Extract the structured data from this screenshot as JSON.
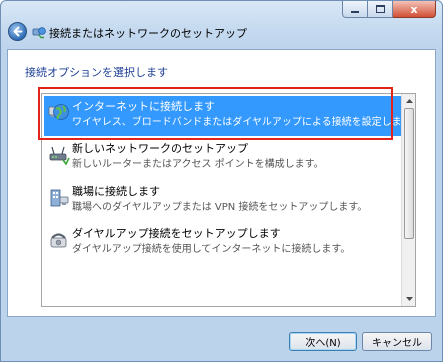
{
  "window": {
    "title": "接続またはネットワークのセットアップ"
  },
  "caption": {
    "close_glyph": "x"
  },
  "content": {
    "heading": "接続オプションを選択します"
  },
  "options": [
    {
      "title": "インターネットに接続します",
      "description": "ワイヤレス、ブロードバンドまたはダイヤルアップによる接続を設定します。",
      "icon": "globe-network-icon",
      "selected": true
    },
    {
      "title": "新しいネットワークのセットアップ",
      "description": "新しいルーターまたはアクセス ポイントを構成します。",
      "icon": "router-setup-icon",
      "selected": false
    },
    {
      "title": "職場に接続します",
      "description": "職場へのダイヤルアップまたは VPN 接続をセットアップします。",
      "icon": "workplace-building-icon",
      "selected": false
    },
    {
      "title": "ダイヤルアップ接続をセットアップします",
      "description": "ダイヤルアップ接続を使用してインターネットに接続します。",
      "icon": "dialup-phone-icon",
      "selected": false
    }
  ],
  "buttons": {
    "next": "次へ(N)",
    "cancel": "キャンセル"
  },
  "colors": {
    "selection": "#3399ff",
    "heading": "#1c3f95",
    "highlight_frame": "#e2231a"
  }
}
